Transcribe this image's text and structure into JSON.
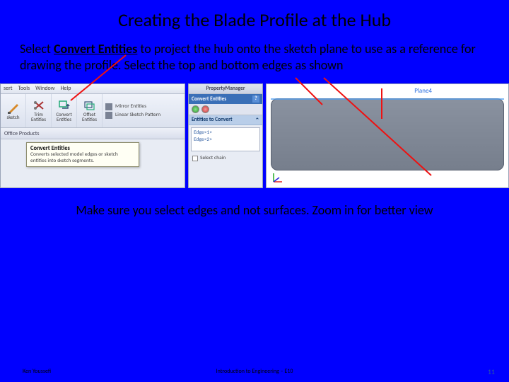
{
  "slide": {
    "title": "Creating the Blade Profile at the Hub",
    "instruction_pre": "Select ",
    "instruction_bold": "Convert Entities",
    "instruction_post": " to project the hub onto the sketch plane to use as a reference for drawing the profile. Select the top and bottom edges as shown",
    "hint": "Make sure you select edges and not surfaces. Zoom in for better view"
  },
  "left": {
    "menu": {
      "m0": "sert",
      "m1": "Tools",
      "m2": "Window",
      "m3": "Help"
    },
    "tools": {
      "sketch": "sketch",
      "trim": "Trim Entities",
      "convert": "Convert Entities",
      "offset": "Offset Entities"
    },
    "small": {
      "mirror": "Mirror Entities",
      "pattern": "Linear Sketch Pattern"
    },
    "office": "Office Products",
    "tooltip": {
      "title": "Convert Entities",
      "body": "Converts selected model edges or sketch entities into sketch segments."
    }
  },
  "mid": {
    "pm": "PropertyManager",
    "title": "Convert Entities",
    "q": "?",
    "section": "Entities to Convert",
    "edge1": "Edge<1>",
    "edge2": "Edge<2>",
    "select_chain": "Select chain"
  },
  "right": {
    "plane": "Plane4"
  },
  "footer": {
    "copyright": "Ken Youssefi",
    "course": "Introduction to Engineering – E10",
    "page": "11"
  }
}
